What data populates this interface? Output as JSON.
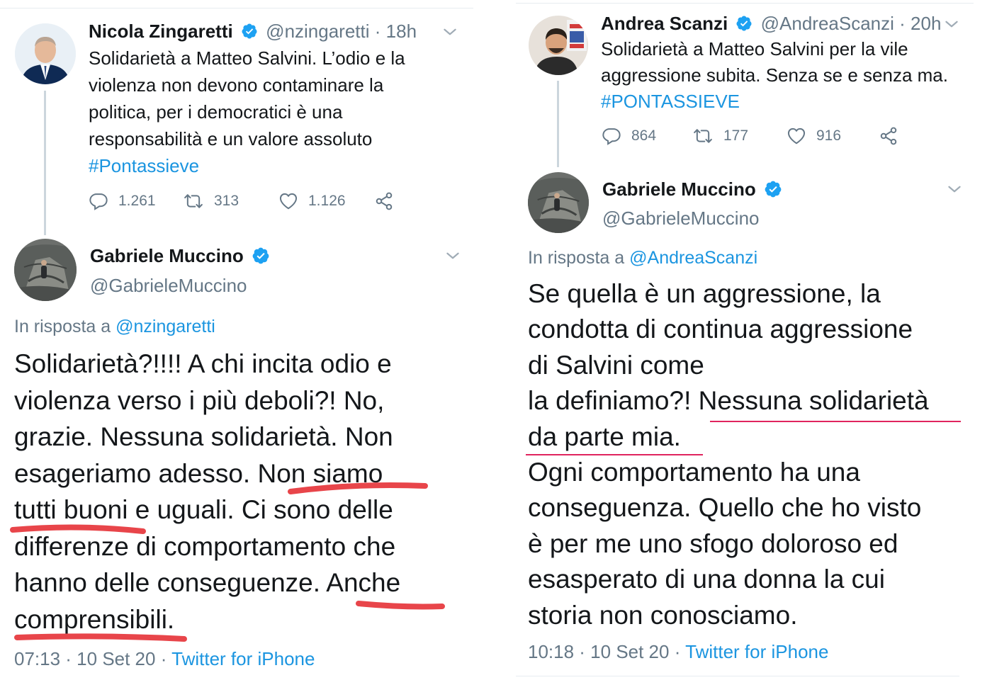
{
  "left": {
    "original": {
      "name": "Nicola Zingaretti",
      "handle": "@nzingaretti",
      "time": "· 18h",
      "line1": "Solidarietà a Matteo Salvini. L’odio e la",
      "line2": "violenza non devono contaminare la",
      "line3": "politica, per i democratici è una",
      "line4": "responsabilità e un valore assoluto",
      "hashtag": "#Pontassieve",
      "replies": "1.261",
      "retweets": "313",
      "likes": "1.126"
    },
    "reply": {
      "name": "Gabriele Muccino",
      "handle": "@GabrieleMuccino",
      "in_reply_prefix": "In risposta a",
      "in_reply_handle": "@nzingaretti",
      "line1": "Solidarietà?!!!! A chi incita odio e",
      "line2": "violenza verso i più deboli?! No,",
      "line3": "grazie. Nessuna solidarietà. Non",
      "line4": "esageriamo adesso. Non siamo",
      "line5": "tutti buoni e uguali. Ci sono delle",
      "line6": "differenze di comportamento che",
      "line7": "hanno delle conseguenze. Anche",
      "line8": "comprensibili.",
      "time": "07:13 · 10 Set 20 ·",
      "client": "Twitter for iPhone"
    }
  },
  "right": {
    "original": {
      "name": "Andrea Scanzi",
      "handle": "@AndreaScanzi",
      "time": "· 20h",
      "line1": "Solidarietà a Matteo Salvini per la vile",
      "line2": "aggressione subita. Senza se e senza ma.",
      "hashtag": "#PONTASSIEVE",
      "replies": "864",
      "retweets": "177",
      "likes": "916"
    },
    "reply": {
      "name": "Gabriele Muccino",
      "handle": "@GabrieleMuccino",
      "in_reply_prefix": "In risposta a",
      "in_reply_handle": "@AndreaScanzi",
      "line1": "Se quella è un aggressione, la",
      "line2": "condotta di continua aggressione",
      "line3": "di Salvini come",
      "line4": "la definiamo?! Nessuna solidarietà",
      "line5": "da parte mia.",
      "line6": "Ogni comportamento ha una",
      "line7": "conseguenza. Quello che ho visto",
      "line8": "è per me uno sfogo doloroso ed",
      "line9": "esasperato di una donna la cui",
      "line10": "storia non conosciamo.",
      "time": "10:18 · 10 Set 20 ·",
      "client": "Twitter for iPhone"
    }
  },
  "colors": {
    "link": "#1b95e0",
    "verified": "#1da1f2",
    "secondary_text": "#657786",
    "marker_red": "#e8454a",
    "underline_red": "#e0245e"
  },
  "icons": [
    "verified-badge-icon",
    "chevron-down-icon",
    "reply-icon",
    "retweet-icon",
    "like-icon",
    "share-icon"
  ]
}
